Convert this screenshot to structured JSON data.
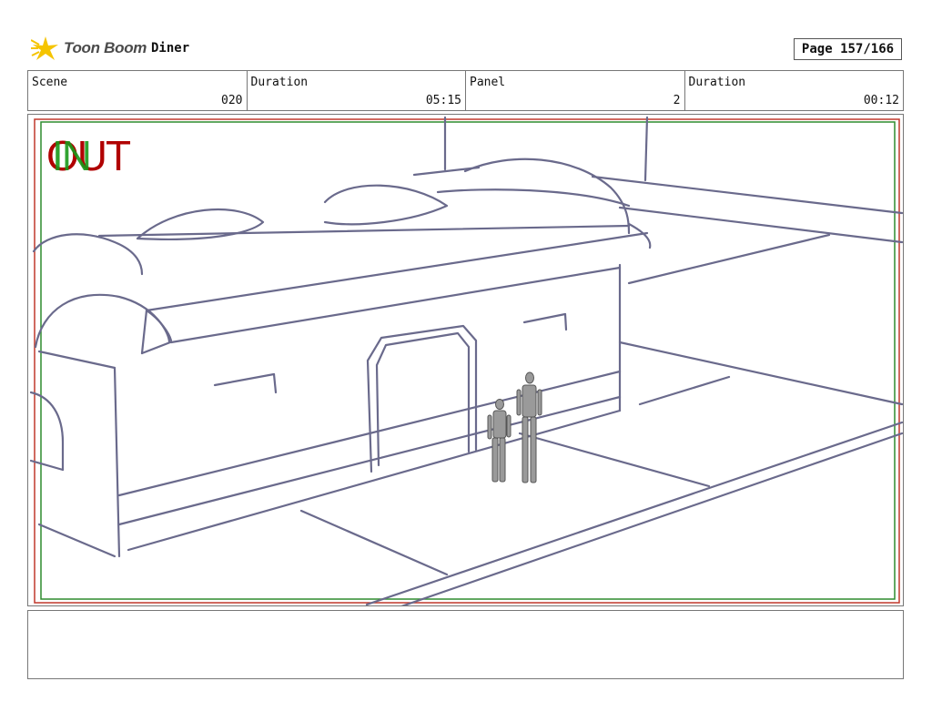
{
  "header": {
    "logo_text": "Toon Boom",
    "project_title": "Diner",
    "page_label": "Page 157/166"
  },
  "info": {
    "scene_label": "Scene",
    "scene_value": "020",
    "scene_duration_label": "Duration",
    "scene_duration_value": "05:15",
    "panel_label": "Panel",
    "panel_value": "2",
    "panel_duration_label": "Duration",
    "panel_duration_value": "00:12"
  },
  "panel": {
    "out_marker": "OUT",
    "in_marker": "IN",
    "frame_colors": {
      "outer": "#c0392b",
      "inner": "#2e8b2e",
      "sketch": "#6a6a8c"
    }
  },
  "notes": {
    "text": ""
  }
}
